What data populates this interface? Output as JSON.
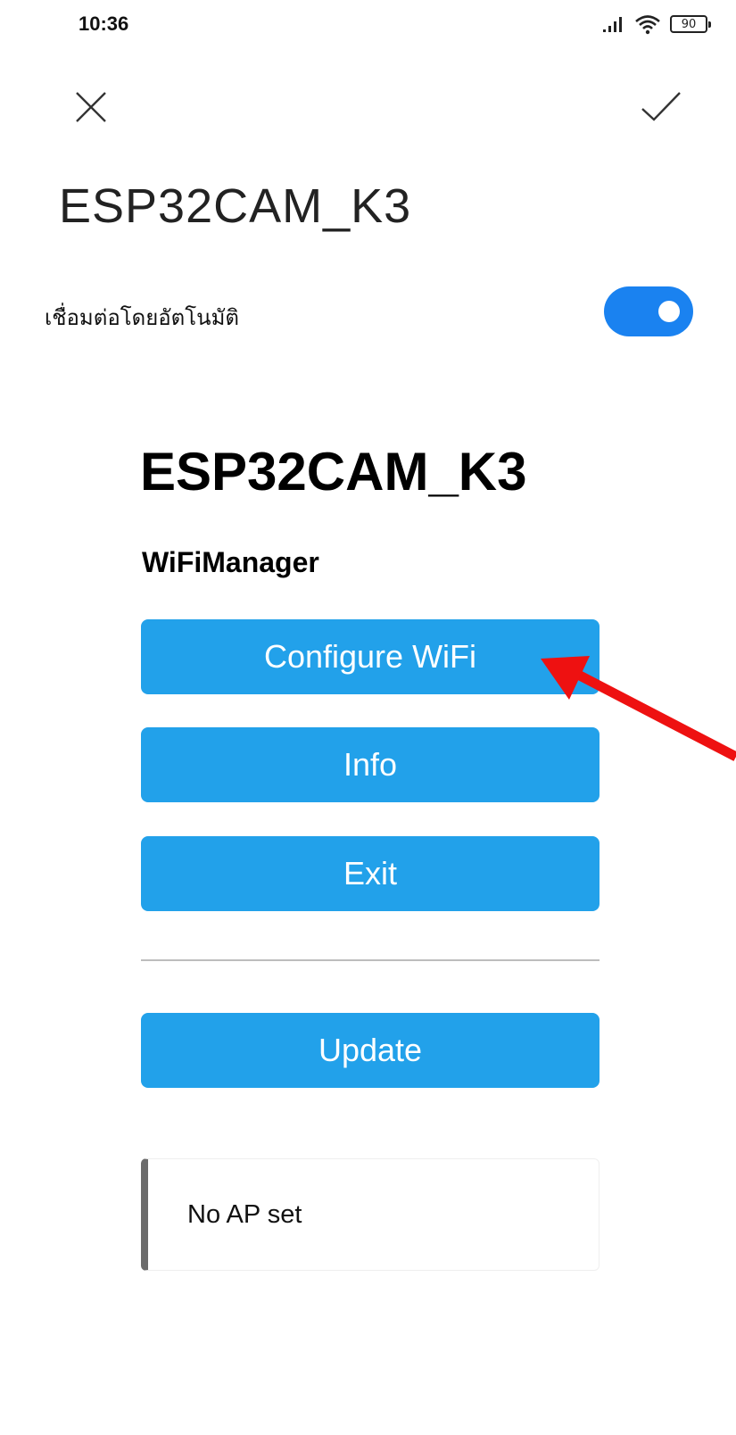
{
  "status_bar": {
    "time": "10:36",
    "battery": "90",
    "icons": [
      "signal-icon",
      "wifi-icon",
      "battery-icon"
    ]
  },
  "top_bar": {
    "icons": [
      "close-icon",
      "checkmark-icon"
    ]
  },
  "network": {
    "name": "ESP32CAM_K3",
    "auto_connect_label": "เชื่อมต่อโดยอัตโนมัติ",
    "auto_connect_enabled": true
  },
  "portal": {
    "title": "ESP32CAM_K3",
    "subtitle": "WiFiManager",
    "buttons": {
      "configure": "Configure WiFi",
      "info": "Info",
      "exit": "Exit",
      "update": "Update"
    },
    "message": "No AP set"
  },
  "colors": {
    "button": "#22a1ea",
    "toggle": "#1a82f0",
    "annotation_arrow": "#ee1111"
  }
}
